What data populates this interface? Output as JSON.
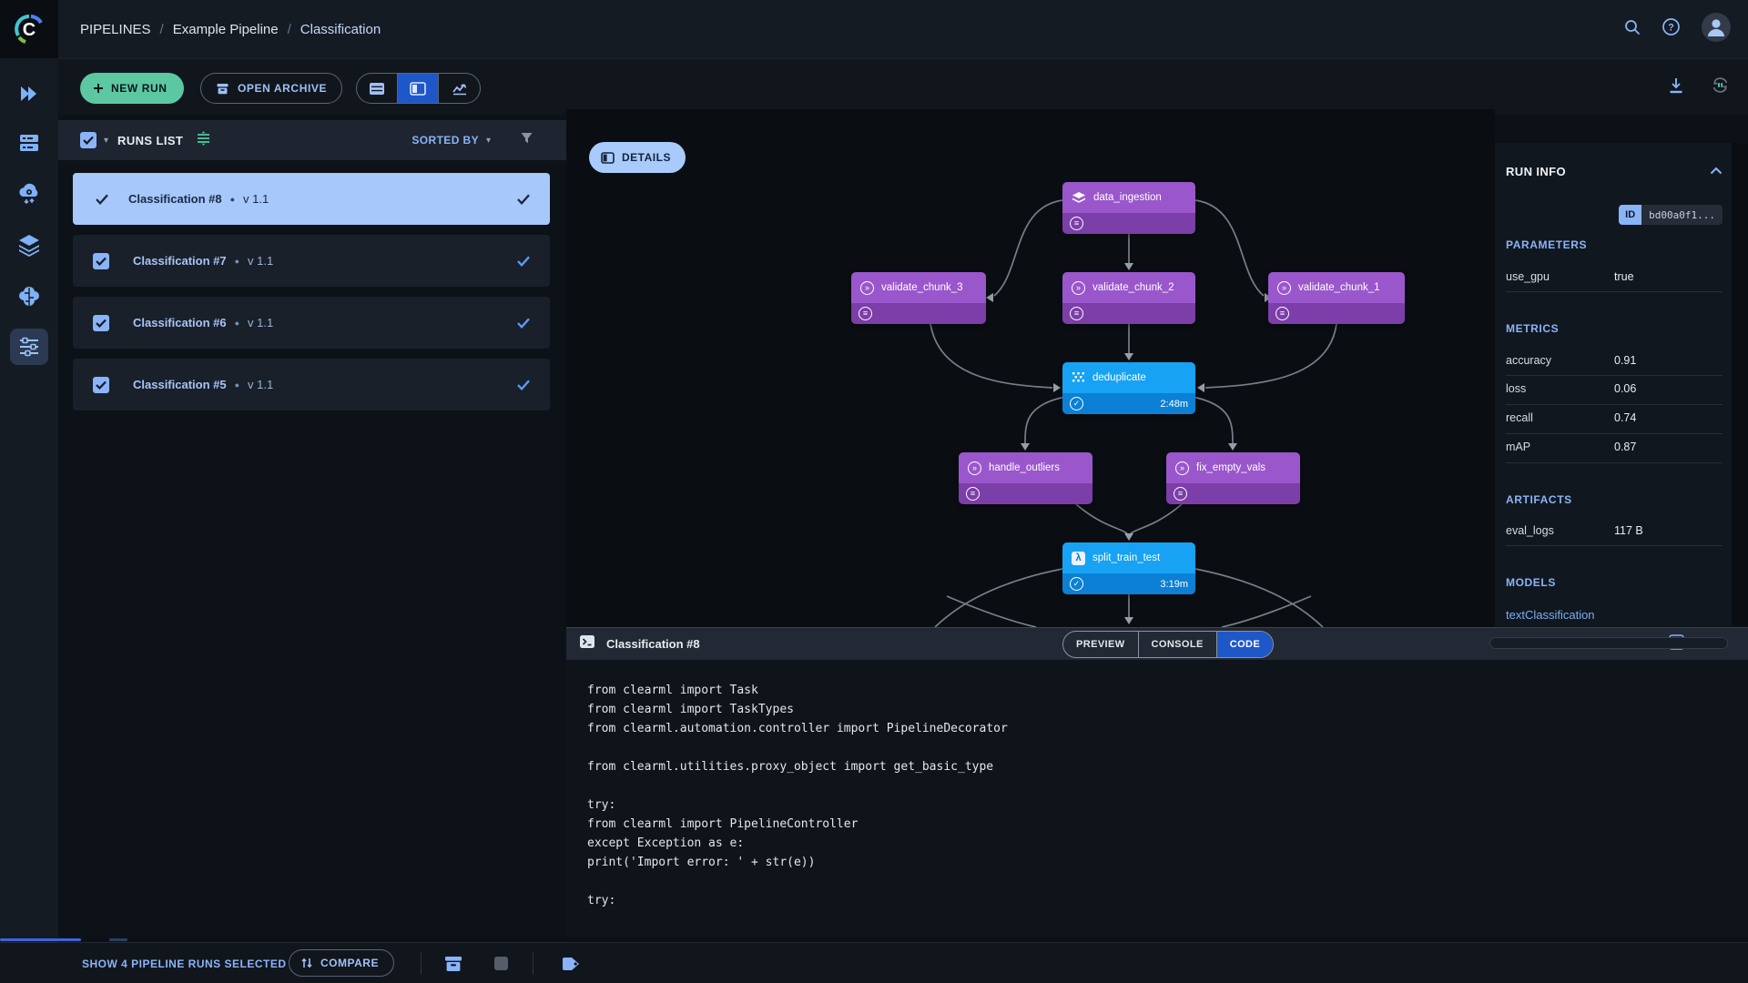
{
  "header": {
    "breadcrumb": {
      "root": "PIPELINES",
      "sep1": "/",
      "project": "Example Pipeline",
      "sep2": "/",
      "current": "Classification"
    }
  },
  "sidebar": {
    "items": [
      {
        "icon": "projects-icon"
      },
      {
        "icon": "datasets-icon"
      },
      {
        "icon": "data-processing-icon"
      },
      {
        "icon": "hyper-datasets-icon"
      },
      {
        "icon": "models-icon"
      },
      {
        "icon": "pipelines-icon",
        "selected": true
      }
    ]
  },
  "toolbar": {
    "new_run_label": "NEW RUN",
    "open_archive_label": "OPEN ARCHIVE",
    "view_icons": [
      "table-view-icon",
      "split-view-icon",
      "charts-view-icon"
    ],
    "right_icons": [
      "download-icon",
      "auto-refresh-icon"
    ]
  },
  "runs_list": {
    "title": "RUNS LIST",
    "sorted_by_label": "SORTED BY",
    "runs": [
      {
        "name": "Classification #8",
        "dot": "●",
        "version": "v 1.1",
        "selected": true
      },
      {
        "name": "Classification #7",
        "dot": "●",
        "version": "v 1.1",
        "selected": false
      },
      {
        "name": "Classification #6",
        "dot": "●",
        "version": "v 1.1",
        "selected": false
      },
      {
        "name": "Classification #5",
        "dot": "●",
        "version": "v 1.1",
        "selected": false
      }
    ]
  },
  "dag": {
    "details_button": "DETAILS",
    "nodes": [
      {
        "label": "data_ingestion",
        "color": "purple",
        "icon": "layers-icon"
      },
      {
        "label": "validate_chunk_3",
        "color": "purple",
        "icon": "circled-chevrons-icon"
      },
      {
        "label": "validate_chunk_2",
        "color": "purple",
        "icon": "circled-chevrons-icon"
      },
      {
        "label": "validate_chunk_1",
        "color": "purple",
        "icon": "circled-chevrons-icon"
      },
      {
        "label": "deduplicate",
        "color": "blue",
        "icon": "dot-grid-icon",
        "time": "2:48m"
      },
      {
        "label": "handle_outliers",
        "color": "purple",
        "icon": "circled-chevrons-icon"
      },
      {
        "label": "fix_empty_vals",
        "color": "purple",
        "icon": "circled-chevrons-icon"
      },
      {
        "label": "split_train_test",
        "color": "blue",
        "icon": "lambda-icon",
        "time": "3:19m"
      }
    ]
  },
  "run_info": {
    "title": "RUN INFO",
    "id_label": "ID",
    "id_value": "bd00a0f1...",
    "parameters_title": "PARAMETERS",
    "parameters": [
      {
        "name": "use_gpu",
        "value": "true"
      }
    ],
    "metrics_title": "METRICS",
    "metrics": [
      {
        "name": "accuracy",
        "value": "0.91"
      },
      {
        "name": "loss",
        "value": "0.06"
      },
      {
        "name": "recall",
        "value": "0.74"
      },
      {
        "name": "mAP",
        "value": "0.87"
      }
    ],
    "artifacts_title": "ARTIFACTS",
    "artifacts": [
      {
        "name": "eval_logs",
        "value": "117 B"
      }
    ],
    "models_title": "MODELS",
    "models": [
      {
        "name": "textClassification"
      }
    ]
  },
  "code_panel": {
    "title": "Classification #8",
    "tabs": [
      {
        "label": "PREVIEW"
      },
      {
        "label": "CONSOLE"
      },
      {
        "label": "CODE",
        "active": true
      }
    ],
    "code": "from clearml import Task\nfrom clearml import TaskTypes\nfrom clearml.automation.controller import PipelineDecorator\n\nfrom clearml.utilities.proxy_object import get_basic_type\n\ntry:\nfrom clearml import PipelineController\nexcept Exception as e:\nprint('Import error: ' + str(e))\n\ntry:"
  },
  "footer": {
    "selected_text": "SHOW 4 PIPELINE RUNS SELECTED",
    "compare_label": "COMPARE",
    "icons": [
      "archive-icon",
      "stop-icon",
      "tag-icon"
    ]
  },
  "colors": {
    "accent_blue": "#1e57c8",
    "light_blue": "#8ab4f8",
    "green": "#5cc8a2",
    "node_purple": "#9a57cc",
    "node_purple_footer": "#7c3ea8",
    "node_blue": "#17a2f3",
    "node_blue_footer": "#0b80d4",
    "selected_row": "#a6c8fb",
    "edge_gray": "#8b939d"
  }
}
